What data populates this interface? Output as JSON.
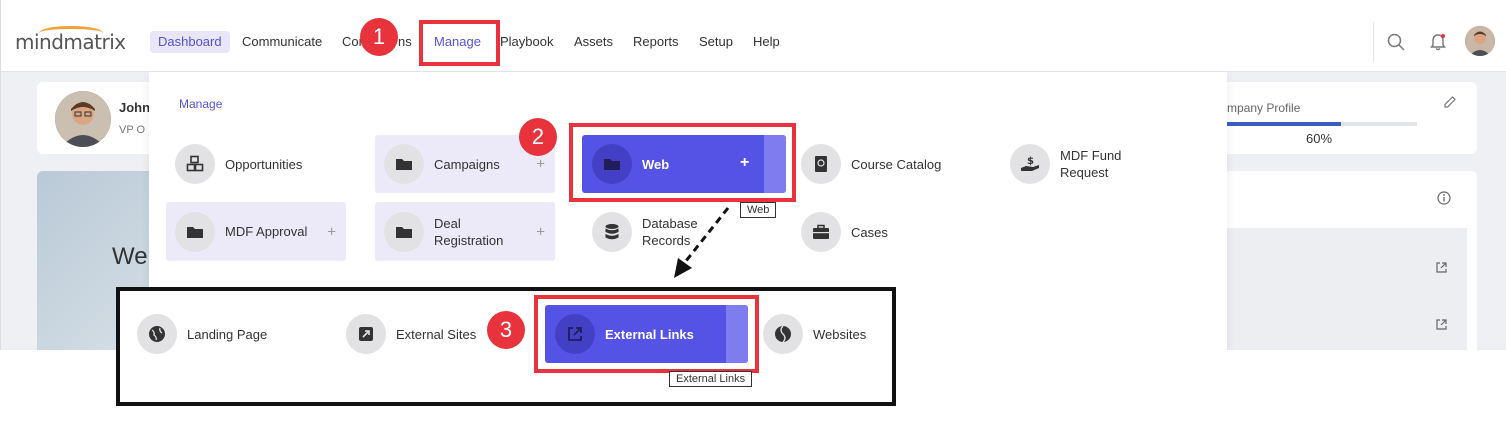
{
  "logo": {
    "text": "mindmatrix"
  },
  "nav": [
    {
      "label": "Dashboard"
    },
    {
      "label": "Communicate"
    },
    {
      "label": "Con"
    },
    {
      "label": "ns"
    },
    {
      "label": "Manage"
    },
    {
      "label": "Playbook"
    },
    {
      "label": "Assets"
    },
    {
      "label": "Reports"
    },
    {
      "label": "Setup"
    },
    {
      "label": "Help"
    }
  ],
  "profile": {
    "name": "John",
    "role": "VP O",
    "completion_label": "mpany Profile",
    "completion_value": "60%",
    "completion_fraction": 0.6
  },
  "hero": {
    "text_we": "We"
  },
  "dropdown": {
    "title": "Manage",
    "items": [
      {
        "label": "Opportunities",
        "icon": "cubes-icon"
      },
      {
        "label": "Campaigns",
        "icon": "folder-icon"
      },
      {
        "label": "Web",
        "icon": "folder-icon"
      },
      {
        "label": "Course Catalog",
        "icon": "book-icon"
      },
      {
        "label": "MDF Fund\nRequest",
        "icon": "hand-dollar-icon"
      },
      {
        "label": "MDF Approval",
        "icon": "folder-icon"
      },
      {
        "label": "Deal\nRegistration",
        "icon": "folder-icon"
      },
      {
        "label": "Database\nRecords",
        "icon": "database-icon"
      },
      {
        "label": "Cases",
        "icon": "briefcase-icon"
      }
    ],
    "plus": "+"
  },
  "tooltips": {
    "web": "Web",
    "external_links": "External Links"
  },
  "submenu": {
    "items": [
      {
        "label": "Landing Page",
        "icon": "globe-icon"
      },
      {
        "label": "External Sites",
        "icon": "external-square-icon"
      },
      {
        "label": "External Links",
        "icon": "external-link-icon"
      },
      {
        "label": "Websites",
        "icon": "globe-dark-icon"
      }
    ]
  },
  "callouts": {
    "one": "1",
    "two": "2",
    "three": "3"
  },
  "colors": {
    "accent": "#5552e6",
    "callout_red": "#e8323c",
    "callout_border": "#111111"
  }
}
